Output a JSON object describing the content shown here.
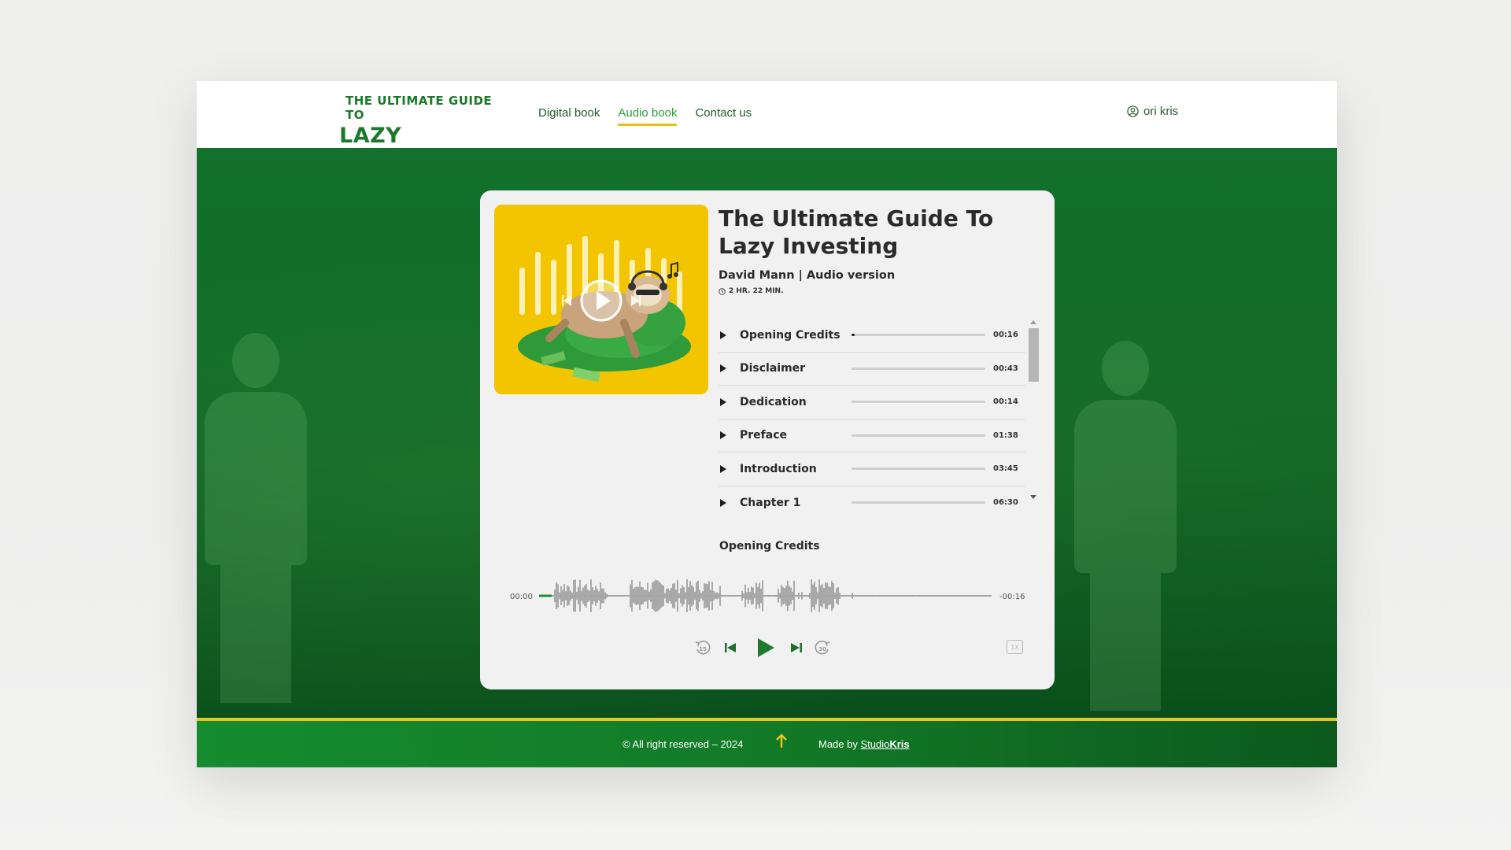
{
  "brand": {
    "logo_top": "THE ULTIMATE GUIDE TO",
    "logo_bottom": "LAZY INVESTING"
  },
  "nav": {
    "items": [
      {
        "label": "Digital book",
        "active": false
      },
      {
        "label": "Audio book",
        "active": true
      },
      {
        "label": "Contact us",
        "active": false
      }
    ]
  },
  "user": {
    "name": "ori kris",
    "icon": "user-circle-icon"
  },
  "player": {
    "title": "The Ultimate Guide To Lazy Investing",
    "subtitle": "David Mann | Audio version",
    "duration": "2 HR. 22 MIN.",
    "tracks": [
      {
        "name": "Opening Credits",
        "time": "00:16",
        "progress": 0.02
      },
      {
        "name": "Disclaimer",
        "time": "00:43",
        "progress": 0
      },
      {
        "name": "Dedication",
        "time": "00:14",
        "progress": 0
      },
      {
        "name": "Preface",
        "time": "01:38",
        "progress": 0
      },
      {
        "name": "Introduction",
        "time": "03:45",
        "progress": 0
      },
      {
        "name": "Chapter 1",
        "time": "06:30",
        "progress": 0
      }
    ],
    "now_playing": "Opening Credits",
    "elapsed": "00:00",
    "remaining": "-00:16",
    "speed": "1X",
    "controls": [
      "rewind-15-icon",
      "skip-previous-icon",
      "play-icon",
      "skip-next-icon",
      "forward-30-icon"
    ],
    "rewind_label": "15",
    "forward_label": "30"
  },
  "footer": {
    "copyright": "© All right reserved – 2024",
    "made_by_prefix": "Made by ",
    "studio_light": "Studio",
    "studio_bold": "Kris"
  },
  "colors": {
    "brand_green": "#1a7a2a",
    "accent_yellow": "#e8c81d",
    "hero_green": "#0e6a25",
    "player_green": "#1f8a34"
  }
}
